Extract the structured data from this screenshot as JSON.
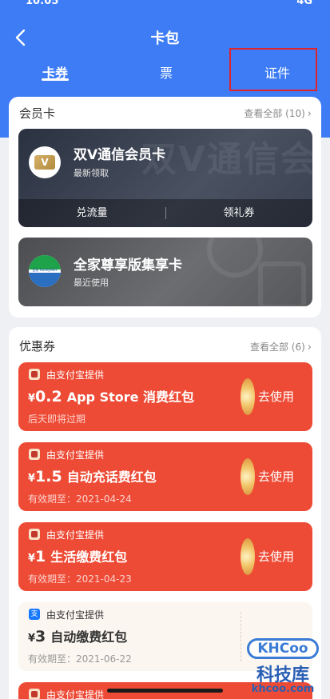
{
  "status": {
    "time": "10:05",
    "network": "4G"
  },
  "header": {
    "title": "卡包"
  },
  "tabs": [
    {
      "label": "卡券",
      "active": true
    },
    {
      "label": "票",
      "active": false
    },
    {
      "label": "证件",
      "active": false
    }
  ],
  "members": {
    "title": "会员卡",
    "more": "查看全部 (10)",
    "cards": [
      {
        "name": "双V通信会员卡",
        "sub": "最新领取",
        "logo_letter": "V",
        "watermark": "双V通信会",
        "actions": [
          "兑流量",
          "领礼券"
        ]
      },
      {
        "name": "全家尊享版集享卡",
        "sub": "最近使用",
        "logo_text": "全家 FamilyMart"
      }
    ]
  },
  "coupons": {
    "title": "优惠券",
    "more": "查看全部 (6)",
    "items": [
      {
        "provider": "由支付宝提供",
        "currency": "¥",
        "amount": "0.2",
        "name": "App Store 消费红包",
        "note": "后天即将过期",
        "action": "去使用",
        "style": "red"
      },
      {
        "provider": "由支付宝提供",
        "currency": "¥",
        "amount": "1.5",
        "name": "自动充话费红包",
        "note": "有效期至：2021-04-24",
        "action": "去使用",
        "style": "red"
      },
      {
        "provider": "由支付宝提供",
        "currency": "¥",
        "amount": "1",
        "name": "生活缴费红包",
        "note": "有效期至：2021-04-23",
        "action": "去使用",
        "style": "red"
      },
      {
        "provider": "由支付宝提供",
        "provider_icon": "支",
        "currency": "¥",
        "amount": "3",
        "name": "自动缴费红包",
        "note": "有效期至：2021-06-22",
        "style": "light"
      },
      {
        "provider": "由支付宝提供",
        "style": "red"
      }
    ]
  },
  "watermark": {
    "top": "KHCoo",
    "middle": "科技库",
    "bottom": "khcoo.com"
  },
  "colors": {
    "primary": "#3d7cf5",
    "coupon_red": "#ee4b36",
    "highlight": "#e0242e"
  }
}
